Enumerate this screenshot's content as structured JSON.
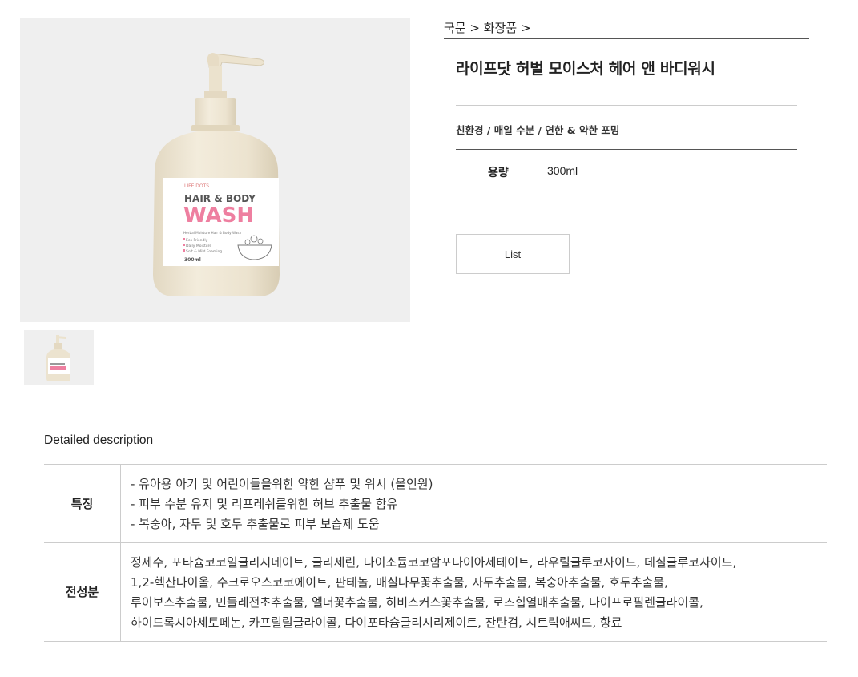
{
  "breadcrumb": {
    "items": [
      "국문",
      "화장품"
    ],
    "separator": ">"
  },
  "product": {
    "title": "라이프닷 허벌 모이스처 헤어 앤 바디워시",
    "features": "친환경 / 매일 수분 / 연한 & 약한 포밍",
    "spec_label": "용량",
    "spec_value": "300ml",
    "list_button": "List"
  },
  "bottle_label": {
    "brand": "LIFE DOTS",
    "line1": "HAIR & BODY",
    "line2": "WASH",
    "subtitle": "Herbal Moisture Hair & Body Wash",
    "checks": [
      "Eco Friendly",
      "Daily Moisture",
      "Soft & Mild Foaming"
    ],
    "volume": "300ml"
  },
  "description": {
    "heading": "Detailed description",
    "rows": [
      {
        "label": "특징",
        "lines": [
          "- 유아용 아기 및 어린이들을위한 약한 샴푸 및 워시 (올인원)",
          "- 피부 수분 유지 및 리프레쉬를위한 허브 추출물 함유",
          "- 복숭아, 자두 및 호두 추출물로 피부 보습제 도움"
        ]
      },
      {
        "label": "전성분",
        "lines": [
          "정제수, 포타슘코코일글리시네이트, 글리세린, 다이소듐코코암포다이아세테이트, 라우릴글루코사이드, 데실글루코사이드,",
          "1,2-헥산다이올, 수크로오스코코에이트, 판테놀, 매실나무꽃추출물, 자두추출물, 복숭아추출물, 호두추출물,",
          "루이보스추출물, 민들레전초추출물, 엘더꽃추출물, 히비스커스꽃추출물, 로즈힙열매추출물, 다이프로필렌글라이콜,",
          "하이드록시아세토페논, 카프릴릴글라이콜, 다이포타슘글리시리제이트, 잔탄검, 시트릭애씨드, 향료"
        ]
      }
    ]
  },
  "colors": {
    "image_bg": "#efefef",
    "bottle": "#ece3cf",
    "wash_text": "#ee7fa0",
    "border": "#cccccc"
  }
}
